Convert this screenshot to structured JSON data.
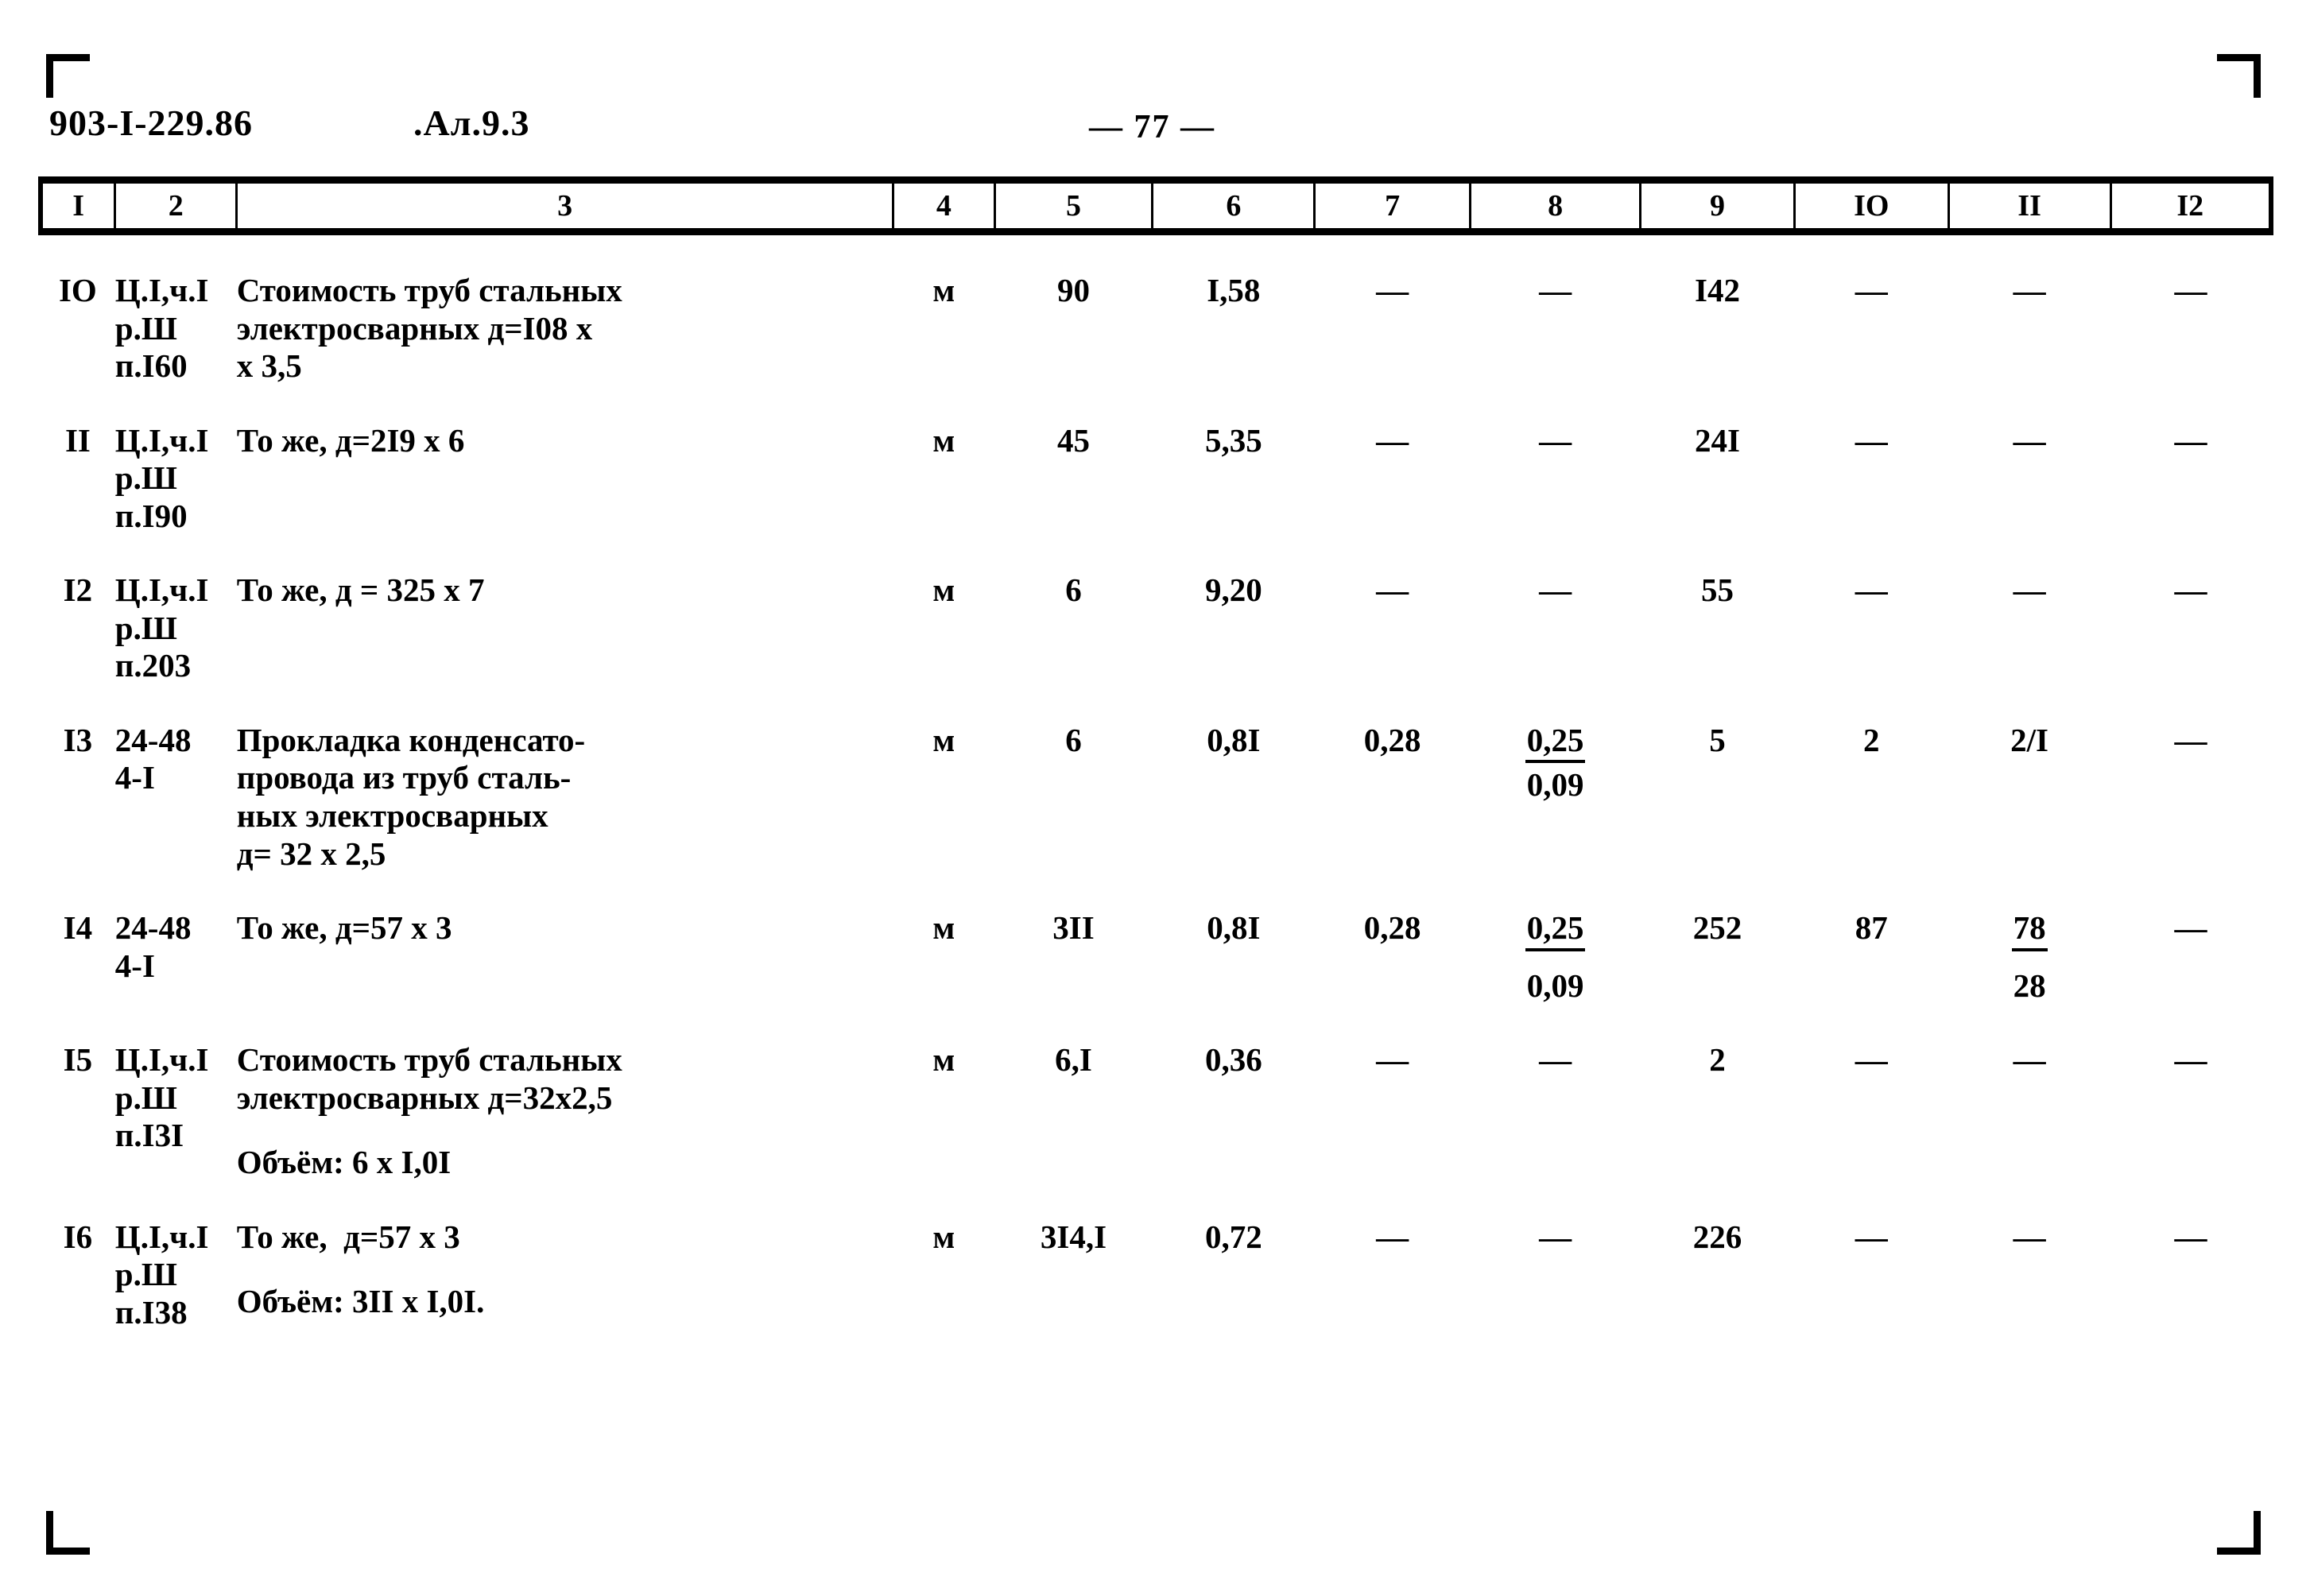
{
  "page": {
    "doc_code": "903-I-229.86",
    "sheet_label": ".Ал.9.3",
    "page_number": "— 77 —"
  },
  "table": {
    "column_headers": [
      "I",
      "2",
      "3",
      "4",
      "5",
      "6",
      "7",
      "8",
      "9",
      "IО",
      "II",
      "I2"
    ],
    "rows": [
      {
        "num": "IО",
        "code": "Ц.I,ч.I\nр.Ш\nп.I60",
        "desc": "Стоимость труб стальных\nэлектросварных д=I08 х\nх 3,5",
        "unit": "м",
        "c5": "90",
        "c6": "I,58",
        "c7": "—",
        "c8": "—",
        "c9": "I42",
        "c10": "—",
        "c11": "—",
        "c12": "—",
        "push": 2
      },
      {
        "num": "II",
        "code": "Ц.I,ч.I\nр.Ш\nп.I90",
        "desc": "То же, д=2I9 х 6",
        "unit": "м",
        "c5": "45",
        "c6": "5,35",
        "c7": "—",
        "c8": "—",
        "c9": "24I",
        "c10": "—",
        "c11": "—",
        "c12": "—",
        "push": 0
      },
      {
        "num": "I2",
        "code": "Ц.I,ч.I\nр.Ш\nп.203",
        "desc": "То же, д = 325 х 7",
        "unit": "м",
        "c5": "6",
        "c6": "9,20",
        "c7": "—",
        "c8": "—",
        "c9": "55",
        "c10": "—",
        "c11": "—",
        "c12": "—",
        "push": 0
      },
      {
        "num": "I3",
        "code": "24-48\n4-I",
        "desc": "Прокладка конденсато-\nпровода из труб сталь-\nных электросварных\nд= 32 х 2,5",
        "unit": "м",
        "c5": "6",
        "c6": "0,8I",
        "c7": "0,28",
        "c8_top": "0,25",
        "c8_bot": "0,09",
        "c9": "5",
        "c10": "2",
        "c11": "2/I",
        "c12": "—",
        "push": 3
      },
      {
        "num": "I4",
        "code": "24-48\n4-I",
        "desc": "То же, д=57 х 3",
        "unit": "м",
        "c5": "3II",
        "c6": "0,8I",
        "c7": "0,28",
        "c8_top": "0,25",
        "c8_bot": "0,09",
        "c9": "252",
        "c10": "87",
        "c11_top": "78",
        "c11_bot": "28",
        "c12": "—",
        "push": 0
      },
      {
        "num": "I5",
        "code": "Ц.I,ч.I\nр.Ш\nп.I3I",
        "desc": "Стоимость труб стальных\nэлектросварных д=32х2,5",
        "desc_extra": "Объём: 6 х I,0I",
        "unit": "м",
        "c5": "6,I",
        "c6": "0,36",
        "c7": "—",
        "c8": "—",
        "c9": "2",
        "c10": "—",
        "c11": "—",
        "c12": "—",
        "push": 1
      },
      {
        "num": "I6",
        "code": "Ц.I,ч.I\nр.Ш\nп.I38",
        "desc": "То же,  д=57 х 3",
        "desc_extra": "Объём: 3II х I,0I.",
        "unit": "м",
        "c5": "3I4,I",
        "c6": "0,72",
        "c7": "—",
        "c8": "—",
        "c9": "226",
        "c10": "—",
        "c11": "—",
        "c12": "—",
        "push": 0
      }
    ]
  }
}
